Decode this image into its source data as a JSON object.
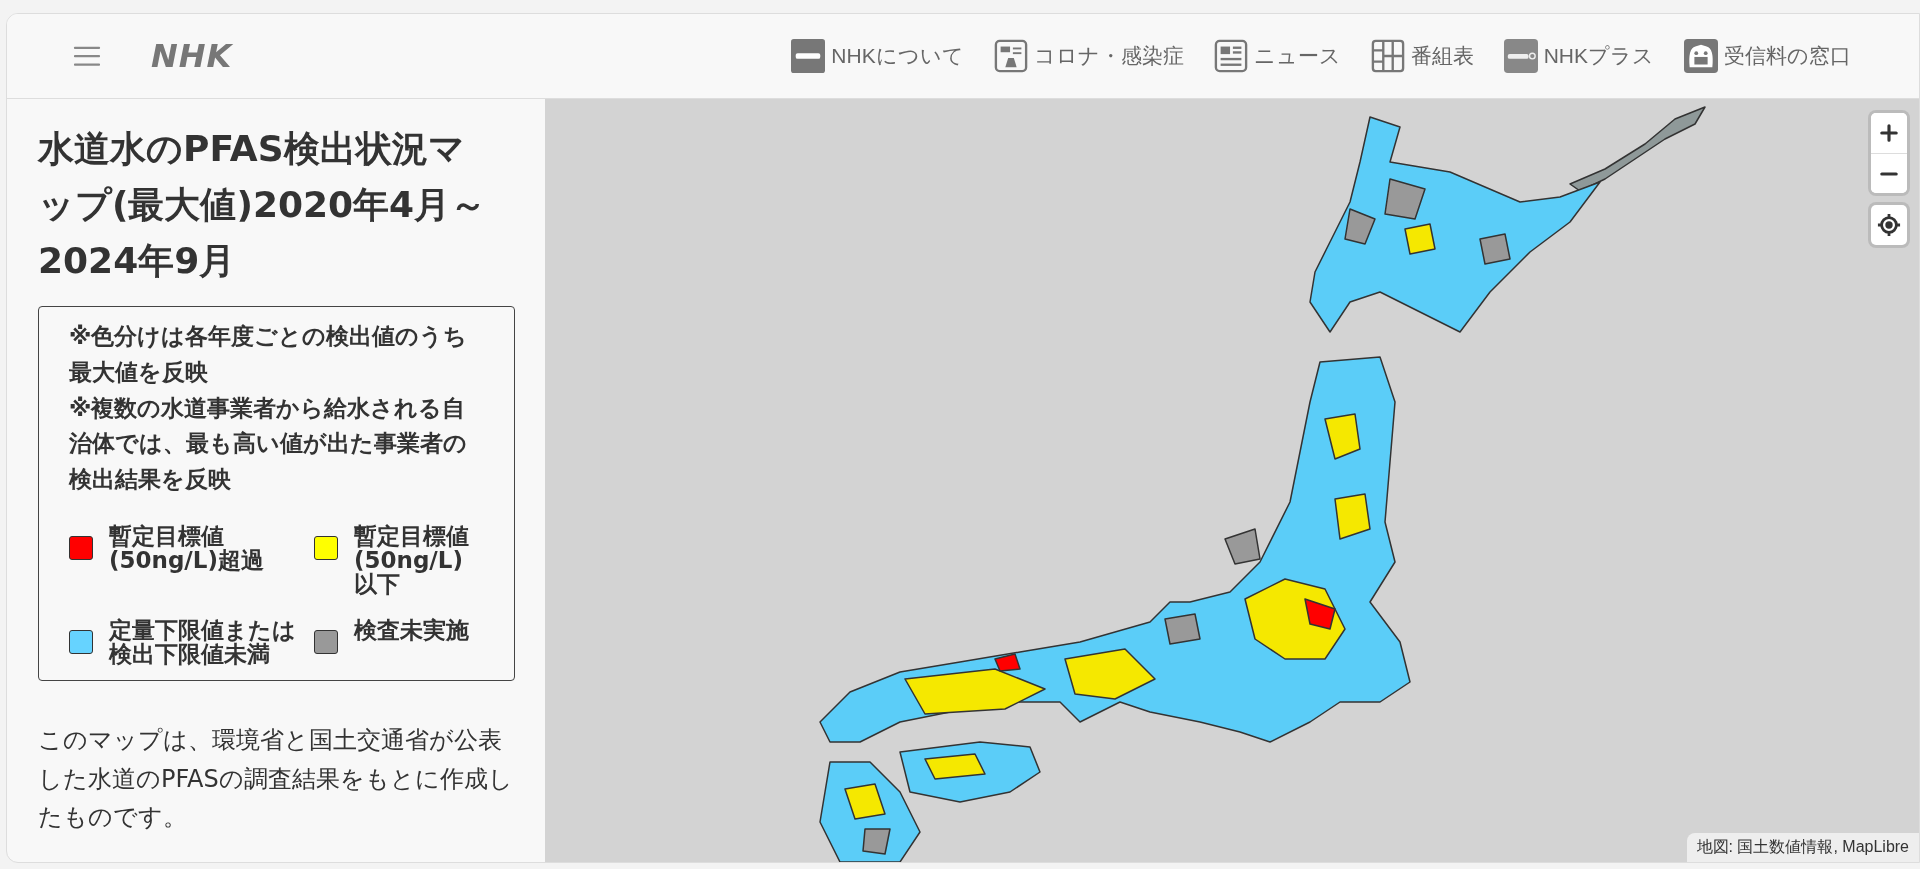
{
  "header": {
    "logo": "NHK",
    "nav": [
      {
        "label": "NHKについて"
      },
      {
        "label": "コロナ・感染症"
      },
      {
        "label": "ニュース"
      },
      {
        "label": "番組表"
      },
      {
        "label": "NHKプラス"
      },
      {
        "label": "受信料の窓口"
      }
    ]
  },
  "sidebar": {
    "title": "水道水のPFAS検出状況マップ(最大値)2020年4月～2024年9月",
    "notes": [
      "※色分けは各年度ごとの検出値のうち最大値を反映",
      "※複数の水道事業者から給水される自治体では、最も高い値が出た事業者の検出結果を反映"
    ],
    "legend": [
      {
        "label": "暫定目標値(50ng/L)超過",
        "color": "#ff0000"
      },
      {
        "label": "暫定目標値(50ng/L)以下",
        "color": "#ffff00"
      },
      {
        "label": "定量下限値または検出下限値未満",
        "color": "#66d3ff"
      },
      {
        "label": "検査未実施",
        "color": "#999999"
      }
    ],
    "description": "このマップは、環境省と国土交通省が公表した水道のPFASの調査結果をもとに作成したものです。"
  },
  "map": {
    "attribution": "地図: 国土数値情報, MapLibre"
  }
}
